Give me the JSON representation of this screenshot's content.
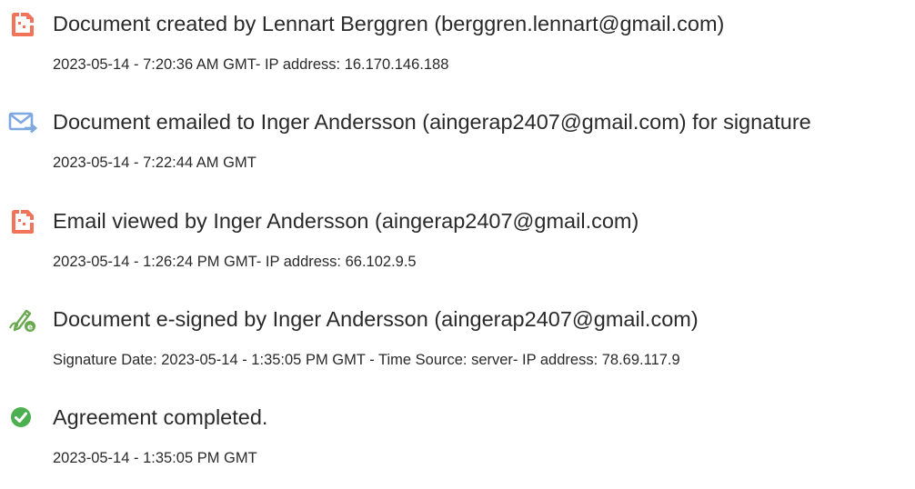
{
  "events": [
    {
      "icon": "document-created-icon",
      "title": "Document created by Lennart Berggren (berggren.lennart@gmail.com)",
      "detail": "2023-05-14 - 7:20:36 AM GMT- IP address: 16.170.146.188"
    },
    {
      "icon": "document-emailed-icon",
      "title": "Document emailed to Inger Andersson (aingerap2407@gmail.com) for signature",
      "detail": "2023-05-14 - 7:22:44 AM GMT"
    },
    {
      "icon": "email-viewed-icon",
      "title": "Email viewed by Inger Andersson (aingerap2407@gmail.com)",
      "detail": "2023-05-14 - 1:26:24 PM GMT- IP address: 66.102.9.5"
    },
    {
      "icon": "e-signed-icon",
      "title": "Document e-signed by Inger Andersson (aingerap2407@gmail.com)",
      "detail": "Signature Date: 2023-05-14 - 1:35:05 PM GMT - Time Source: server- IP address: 78.69.117.9"
    },
    {
      "icon": "agreement-completed-icon",
      "title": "Agreement completed.",
      "detail": "2023-05-14 - 1:35:05 PM GMT"
    }
  ],
  "colors": {
    "document_icon": "#f0735a",
    "email_icon": "#7fa8e0",
    "sign_icon": "#6aa84f",
    "check_icon": "#4caf50"
  }
}
